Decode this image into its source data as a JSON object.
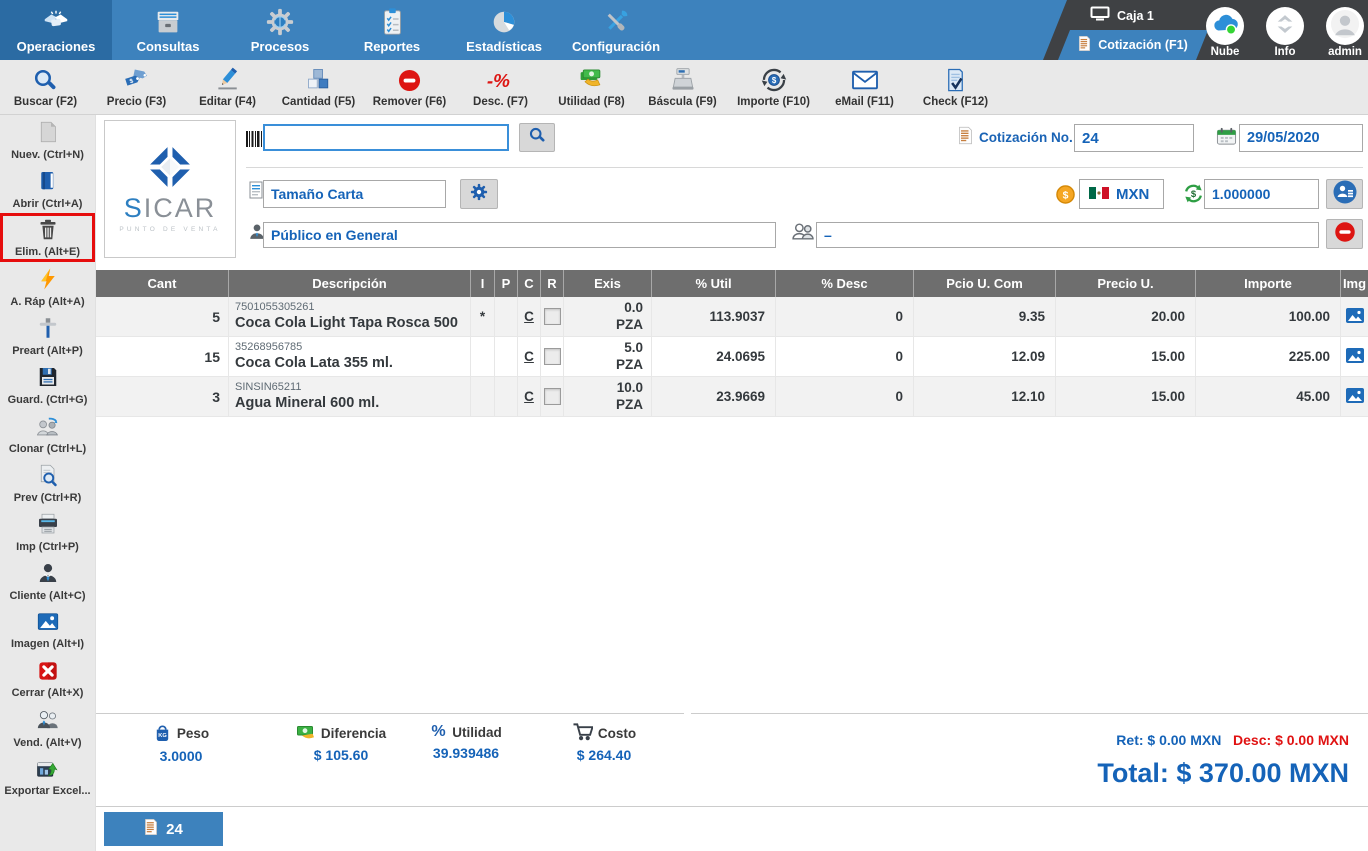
{
  "colors": {
    "topbar_blue": "#3d82bd",
    "topbar_selected_blue": "#2b6ba3",
    "panel_dark": "#3f4144",
    "accent_blue": "#1563b8",
    "alert_red": "#e01212",
    "highlight_box_red": "#e60d0d",
    "table_header_gray": "#6e6e6e",
    "row_alt_gray": "#f2f2f2",
    "toolbar_gray": "#e9e9e9"
  },
  "topbar": {
    "menus": [
      {
        "label": "Operaciones",
        "icon": "handshake-icon",
        "selected": true
      },
      {
        "label": "Consultas",
        "icon": "archive-icon",
        "selected": false
      },
      {
        "label": "Procesos",
        "icon": "gear-icon",
        "selected": false
      },
      {
        "label": "Reportes",
        "icon": "clipboard-icon",
        "selected": false
      },
      {
        "label": "Estadísticas",
        "icon": "pie-chart-icon",
        "selected": false
      },
      {
        "label": "Configuración",
        "icon": "tools-icon",
        "selected": false
      }
    ],
    "caja": "Caja 1",
    "active_tab": "Cotización (F1)",
    "tray": [
      {
        "label": "Nube",
        "icon": "cloud-icon"
      },
      {
        "label": "Info",
        "icon": "info-icon"
      },
      {
        "label": "admin",
        "icon": "user-avatar-icon"
      }
    ]
  },
  "toolbar": {
    "items": [
      {
        "label": "Buscar (F2)",
        "icon": "search-icon"
      },
      {
        "label": "Precio (F3)",
        "icon": "price-tags-icon"
      },
      {
        "label": "Editar (F4)",
        "icon": "pencil-icon"
      },
      {
        "label": "Cantidad (F5)",
        "icon": "boxes-icon"
      },
      {
        "label": "Remover (F6)",
        "icon": "minus-circle-icon"
      },
      {
        "label": "Desc. (F7)",
        "icon": "discount-icon"
      },
      {
        "label": "Utilidad (F8)",
        "icon": "money-hand-icon"
      },
      {
        "label": "Báscula (F9)",
        "icon": "scale-icon"
      },
      {
        "label": "Importe (F10)",
        "icon": "coin-cycle-icon"
      },
      {
        "label": "eMail (F11)",
        "icon": "envelope-icon"
      },
      {
        "label": "Check (F12)",
        "icon": "check-doc-icon"
      }
    ]
  },
  "sidebar": {
    "items": [
      {
        "label": "Nuev. (Ctrl+N)",
        "icon": "new-document-icon",
        "highlighted": false
      },
      {
        "label": "Abrir (Ctrl+A)",
        "icon": "open-book-icon",
        "highlighted": false
      },
      {
        "label": "Elim. (Alt+E)",
        "icon": "trash-icon",
        "highlighted": true
      },
      {
        "label": "A. Ráp (Alt+A)",
        "icon": "lightning-icon",
        "highlighted": false
      },
      {
        "label": "Preart (Alt+P)",
        "icon": "pin-icon",
        "highlighted": false
      },
      {
        "label": "Guard. (Ctrl+G)",
        "icon": "floppy-icon",
        "highlighted": false
      },
      {
        "label": "Clonar (Ctrl+L)",
        "icon": "clone-people-icon",
        "highlighted": false
      },
      {
        "label": "Prev (Ctrl+R)",
        "icon": "preview-icon",
        "highlighted": false
      },
      {
        "label": "Imp (Ctrl+P)",
        "icon": "printer-icon",
        "highlighted": false
      },
      {
        "label": "Cliente (Alt+C)",
        "icon": "client-icon",
        "highlighted": false
      },
      {
        "label": "Imagen (Alt+I)",
        "icon": "image-icon",
        "highlighted": false
      },
      {
        "label": "Cerrar (Alt+X)",
        "icon": "close-x-icon",
        "highlighted": false
      },
      {
        "label": "Vend. (Alt+V)",
        "icon": "vendors-icon",
        "highlighted": false
      },
      {
        "label": "Exportar Excel...",
        "icon": "excel-export-icon",
        "highlighted": false
      }
    ]
  },
  "panel": {
    "brand_prefix": "S",
    "brand_rest": "ICAR",
    "tagline": "PUNTO DE VENTA",
    "barcode_value": "",
    "quote_label": "Cotización No.",
    "quote_number": "24",
    "date": "29/05/2020",
    "page_size": "Tamaño Carta",
    "currency_code": "MXN",
    "exchange_rate": "1.000000",
    "customer": "Público en General",
    "vendor_value": "–"
  },
  "table": {
    "columns": [
      "Cant",
      "Descripción",
      "I",
      "P",
      "C",
      "R",
      "Exis",
      "% Util",
      "% Desc",
      "Pcio U. Com",
      "Precio U.",
      "Importe",
      "Img"
    ],
    "rows": [
      {
        "cant": "5",
        "code": "7501055305261",
        "name": "Coca Cola Light Tapa Rosca 500",
        "flag_i": "*",
        "link_c": "C",
        "exis_qty": "0.0",
        "exis_unit": "PZA",
        "util_pct": "113.9037",
        "desc_pct": "0",
        "cost_unit": "9.35",
        "price_unit": "20.00",
        "amount": "100.00"
      },
      {
        "cant": "15",
        "code": "35268956785",
        "name": "Coca Cola Lata 355 ml.",
        "flag_i": "",
        "link_c": "C",
        "exis_qty": "5.0",
        "exis_unit": "PZA",
        "util_pct": "24.0695",
        "desc_pct": "0",
        "cost_unit": "12.09",
        "price_unit": "15.00",
        "amount": "225.00"
      },
      {
        "cant": "3",
        "code": "SINSIN65211",
        "name": "Agua Mineral 600 ml.",
        "flag_i": "",
        "link_c": "C",
        "exis_qty": "10.0",
        "exis_unit": "PZA",
        "util_pct": "23.9669",
        "desc_pct": "0",
        "cost_unit": "12.10",
        "price_unit": "15.00",
        "amount": "45.00"
      }
    ]
  },
  "summary": {
    "stats": [
      {
        "label": "Peso",
        "value": "3.0000",
        "icon": "weight-bag-icon"
      },
      {
        "label": "Diferencia",
        "value": "$ 105.60",
        "icon": "money-bill-icon"
      },
      {
        "label": "Utilidad",
        "value": "39.939486",
        "icon": "percent-icon"
      },
      {
        "label": "Costo",
        "value": "$ 264.40",
        "icon": "cart-icon"
      }
    ],
    "ret_label": "Ret:",
    "ret_value": "$ 0.00 MXN",
    "desc_label": "Desc:",
    "desc_value": "$ 0.00 MXN",
    "total_label": "Total:",
    "total_value": "$ 370.00 MXN"
  },
  "footer": {
    "tab_number": "24"
  }
}
